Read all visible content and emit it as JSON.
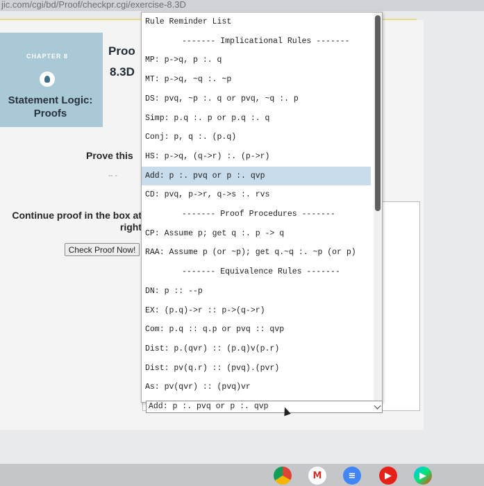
{
  "browser": {
    "url_fragment": "jic.com/cgi/bd/Proof/checkpr.cgi/exercise-8.3D"
  },
  "sidebar": {
    "chapter_label": "CHAPTER 8",
    "chapter_title": "Statement Logic: Proofs"
  },
  "header": {
    "title": "Proo",
    "section": "8.3D"
  },
  "main": {
    "prove_label": "Prove this",
    "prove_value": "-- -",
    "continue_label": "Continue proof in the box at right",
    "check_button": "Check Proof Now!"
  },
  "rule_list": {
    "selected_index": 7,
    "items": [
      "Rule Reminder List",
      "------- Implicational Rules -------",
      "MP: p->q, p :. q",
      "MT: p->q, ~q :. ~p",
      "DS: pvq, ~p :. q or pvq, ~q :. p",
      "Simp: p.q :. p or p.q :. q",
      "Conj: p, q :. (p.q)",
      "HS: p->q, (q->r) :. (p->r)",
      "Add: p :. pvq or p :. qvp",
      "CD: pvq, p->r, q->s :. rvs",
      "------- Proof Procedures -------",
      "CP: Assume p; get q :. p -> q",
      "RAA: Assume p (or ~p); get q.~q :. ~p (or p)",
      "------- Equivalence Rules -------",
      "DN: p :: --p",
      "EX: (p.q)->r :: p->(q->r)",
      "Com: p.q :: q.p or pvq :: qvp",
      "Dist: p.(qvr) :: (p.q)v(p.r)",
      "Dist: pv(q.r) :: (pvq).(pvr)",
      "As: pv(qvr) :: (pvq)vr"
    ]
  },
  "select": {
    "value": "Add: p :. pvq or p :. qvp"
  },
  "taskbar": {
    "icons": [
      "chrome-icon",
      "gmail-icon",
      "docs-icon",
      "youtube-icon",
      "play-store-icon"
    ]
  },
  "colors": {
    "chapter_bg": "#a9c9d6",
    "selected_row": "#c8dcec",
    "page_bg": "#f4f4f4"
  }
}
